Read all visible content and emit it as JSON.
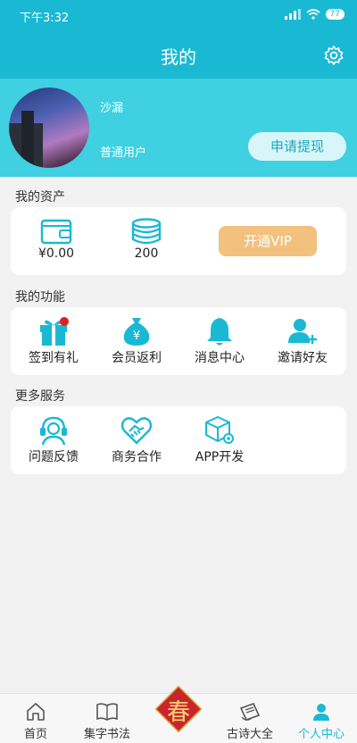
{
  "status": {
    "time": "下午3:32",
    "battery": "77"
  },
  "header": {
    "title": "我的"
  },
  "profile": {
    "name": "沙漏",
    "type": "普通用户",
    "withdraw_label": "申请提现"
  },
  "assets": {
    "section_title": "我的资产",
    "balance": "¥0.00",
    "coins": "200",
    "vip_label": "开通VIP"
  },
  "functions": {
    "section_title": "我的功能",
    "items": [
      {
        "label": "签到有礼",
        "icon": "gift-icon"
      },
      {
        "label": "会员返利",
        "icon": "money-bag-icon"
      },
      {
        "label": "消息中心",
        "icon": "bell-icon"
      },
      {
        "label": "邀请好友",
        "icon": "add-user-icon"
      }
    ]
  },
  "services": {
    "section_title": "更多服务",
    "items": [
      {
        "label": "问题反馈",
        "icon": "headset-icon"
      },
      {
        "label": "商务合作",
        "icon": "handshake-icon"
      },
      {
        "label": "APP开发",
        "icon": "box-gear-icon"
      }
    ]
  },
  "tabs": [
    {
      "label": "首页",
      "icon": "home-icon"
    },
    {
      "label": "集字书法",
      "icon": "book-icon"
    },
    {
      "label": "古诗大全",
      "icon": "scroll-icon"
    },
    {
      "label": "个人中心",
      "icon": "person-icon"
    }
  ],
  "colors": {
    "primary": "#19b9d4",
    "light": "#3fd0e2",
    "vip": "#f2c17e",
    "badge": "#e02020"
  }
}
